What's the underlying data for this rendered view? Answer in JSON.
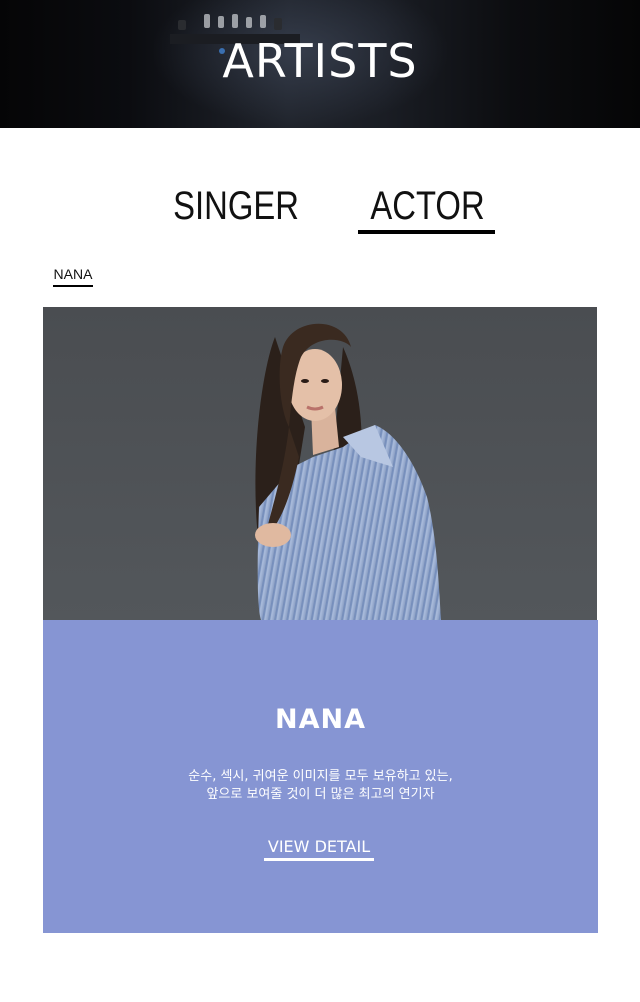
{
  "header": {
    "title": "ARTISTS"
  },
  "tabs": [
    {
      "label": "SINGER",
      "active": false
    },
    {
      "label": "ACTOR",
      "active": true
    }
  ],
  "subnav": {
    "items": [
      {
        "label": "NANA",
        "active": true
      }
    ]
  },
  "artist_card": {
    "name": "NANA",
    "description_line1": "순수, 섹시, 귀여운 이미지를 모두 보유하고 있는,",
    "description_line2": "앞으로 보여줄 것이 더 많은 최고의 연기자",
    "view_detail_label": "VIEW DETAIL",
    "info_bg_color": "#8695d3",
    "photo_bg_color": "#4f5256"
  }
}
